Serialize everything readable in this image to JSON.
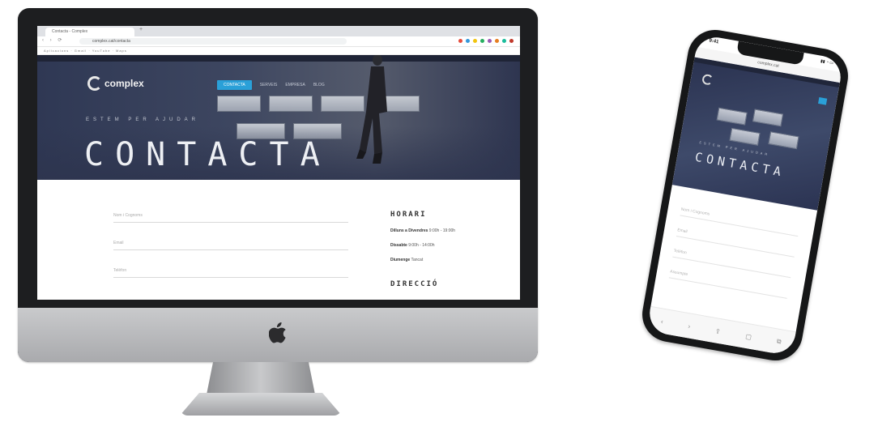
{
  "desktop": {
    "browser": {
      "tab_title": "Contacta - Complex",
      "url": "complex.cat/contacta",
      "nav_arrows": "‹ › ⟳",
      "bookmarks": "Aplicacions  ·  Gmail  ·  YouTube  ·  Maps",
      "extension_colors": [
        "#e74c3c",
        "#3498db",
        "#f1c40f",
        "#27ae60",
        "#9b59b6",
        "#e67e22",
        "#1abc9c",
        "#c0392b"
      ]
    },
    "site": {
      "logo_text": "complex",
      "menu_active": "CONTACTA",
      "menu_items": [
        "SERVEIS",
        "EMPRESA",
        "BLOG"
      ],
      "hero_eyebrow": "ESTEM PER AJUDAR",
      "hero_title": "CONTACTA",
      "form_fields": [
        "Nom i Cognoms",
        "Email",
        "Telèfon"
      ],
      "sidebar": {
        "hours_heading": "HORARI",
        "hours_lines": [
          {
            "label": "Dilluns a Divendres",
            "value": "9:00h - 19:00h"
          },
          {
            "label": "Dissabte",
            "value": "9:00h - 14:00h"
          },
          {
            "label": "Diumenge",
            "value": "Tancat"
          }
        ],
        "address_heading": "DIRECCIÓ"
      }
    }
  },
  "mobile": {
    "status_time": "9:41",
    "status_icons": "▮▮ ◔ ▭",
    "url": "complex.cat",
    "hero_eyebrow": "ESTEM PER AJUDAR",
    "hero_title": "CONTACTA",
    "form_fields": [
      "Nom i Cognoms",
      "Email",
      "Telèfon",
      "Assumpte"
    ],
    "bottom_bar": [
      "‹",
      "›",
      "⇪",
      "▢",
      "⧉"
    ]
  }
}
